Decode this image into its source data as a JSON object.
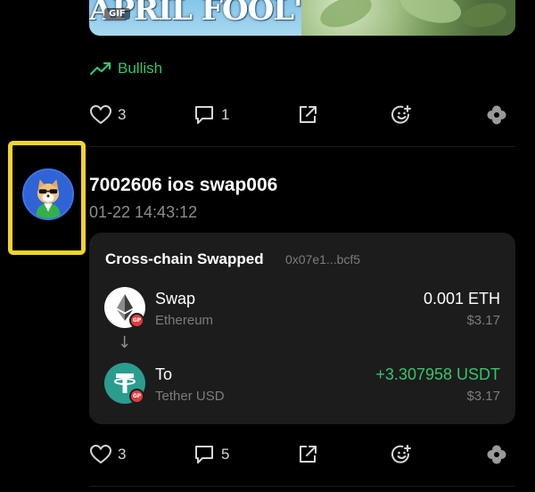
{
  "prev_post": {
    "media": {
      "banner_text": "APRIL FOOL'S DA",
      "gif_badge": "GIF"
    },
    "sentiment": "Bullish",
    "likes": "3",
    "comments": "1"
  },
  "post": {
    "username": "7002606 ios swap006",
    "timestamp": "01-22 14:43:12",
    "card": {
      "title": "Cross-chain Swapped",
      "hash": "0x07e1...bcf5",
      "from": {
        "label": "Swap",
        "chain": "Ethereum",
        "amount": "0.001 ETH",
        "usd": "$3.17",
        "badge": "GP",
        "icon": "ethereum-icon"
      },
      "to": {
        "label": "To",
        "chain": "Tether USD",
        "amount": "+3.307958 USDT",
        "usd": "$3.17",
        "badge": "GP",
        "icon": "tether-icon"
      },
      "arrow": "↓"
    },
    "likes": "3",
    "comments": "5"
  },
  "colors": {
    "background": "#000000",
    "card": "#1c1c1c",
    "positive": "#35c46a",
    "highlight": "#f2d42b",
    "muted": "#7c7c7c"
  }
}
